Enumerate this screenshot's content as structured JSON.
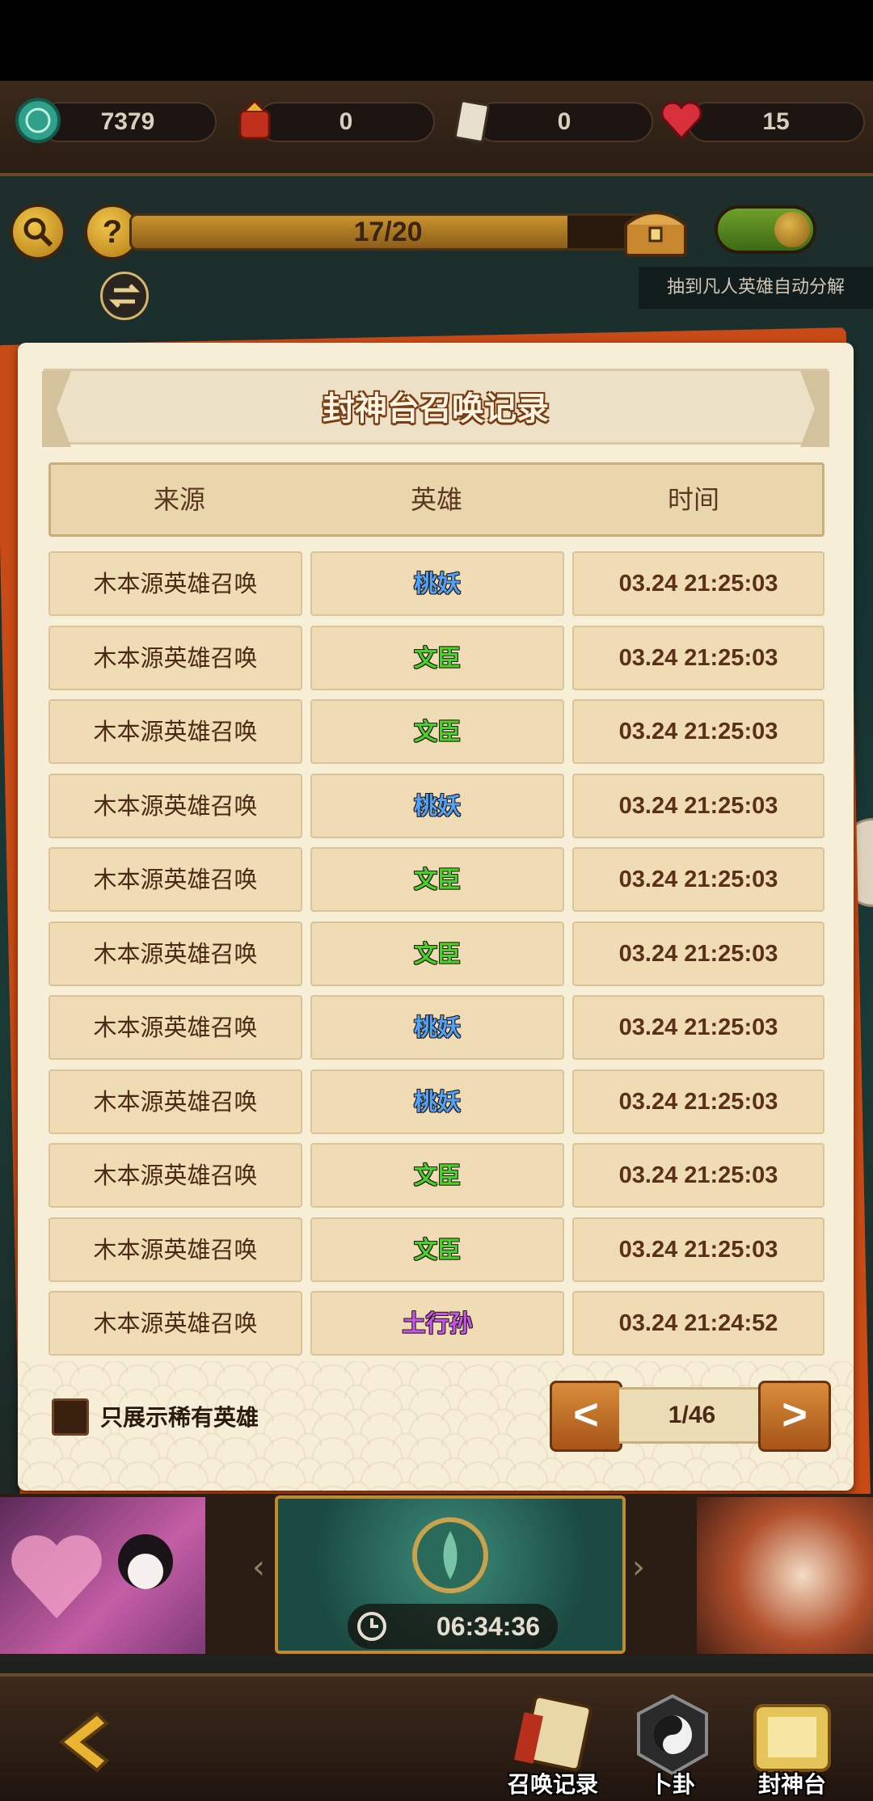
{
  "resources": [
    {
      "icon": "jade-coin-icon",
      "value": "7379"
    },
    {
      "icon": "lucky-bag-icon",
      "value": "0"
    },
    {
      "icon": "scroll-ticket-icon",
      "value": "0"
    },
    {
      "icon": "heart-icon",
      "value": "15"
    }
  ],
  "progress": {
    "text": "17/20",
    "current": 17,
    "total": 20
  },
  "auto_decompose_label": "抽到凡人英雄自动分解",
  "auto_decompose_enabled": true,
  "dialog": {
    "title": "封神台召唤记录",
    "columns": [
      "来源",
      "英雄",
      "时间"
    ],
    "rows": [
      {
        "source": "木本源英雄召唤",
        "hero": "桃妖",
        "hero_color": "#4fa3ff",
        "time": "03.24 21:25:03"
      },
      {
        "source": "木本源英雄召唤",
        "hero": "文臣",
        "hero_color": "#46d12c",
        "time": "03.24 21:25:03"
      },
      {
        "source": "木本源英雄召唤",
        "hero": "文臣",
        "hero_color": "#46d12c",
        "time": "03.24 21:25:03"
      },
      {
        "source": "木本源英雄召唤",
        "hero": "桃妖",
        "hero_color": "#4fa3ff",
        "time": "03.24 21:25:03"
      },
      {
        "source": "木本源英雄召唤",
        "hero": "文臣",
        "hero_color": "#46d12c",
        "time": "03.24 21:25:03"
      },
      {
        "source": "木本源英雄召唤",
        "hero": "文臣",
        "hero_color": "#46d12c",
        "time": "03.24 21:25:03"
      },
      {
        "source": "木本源英雄召唤",
        "hero": "桃妖",
        "hero_color": "#4fa3ff",
        "time": "03.24 21:25:03"
      },
      {
        "source": "木本源英雄召唤",
        "hero": "桃妖",
        "hero_color": "#4fa3ff",
        "time": "03.24 21:25:03"
      },
      {
        "source": "木本源英雄召唤",
        "hero": "文臣",
        "hero_color": "#46d12c",
        "time": "03.24 21:25:03"
      },
      {
        "source": "木本源英雄召唤",
        "hero": "文臣",
        "hero_color": "#46d12c",
        "time": "03.24 21:25:03"
      },
      {
        "source": "木本源英雄召唤",
        "hero": "土行孙",
        "hero_color": "#c455f2",
        "time": "03.24 21:24:52"
      }
    ],
    "rare_only_label": "只展示稀有英雄",
    "rare_only_checked": false,
    "prev_label": "<",
    "next_label": ">",
    "page_indicator": "1/46"
  },
  "banner": {
    "timer": "06:34:36"
  },
  "bottom_nav": [
    {
      "label": "召唤记录",
      "icon": "record-book-icon"
    },
    {
      "label": "卜卦",
      "icon": "yin-yang-icon"
    },
    {
      "label": "封神台",
      "icon": "fengshen-scroll-icon"
    }
  ],
  "colors": {
    "accent": "#c84a16",
    "panel": "#f7eed7",
    "cell": "#efdcb5"
  }
}
